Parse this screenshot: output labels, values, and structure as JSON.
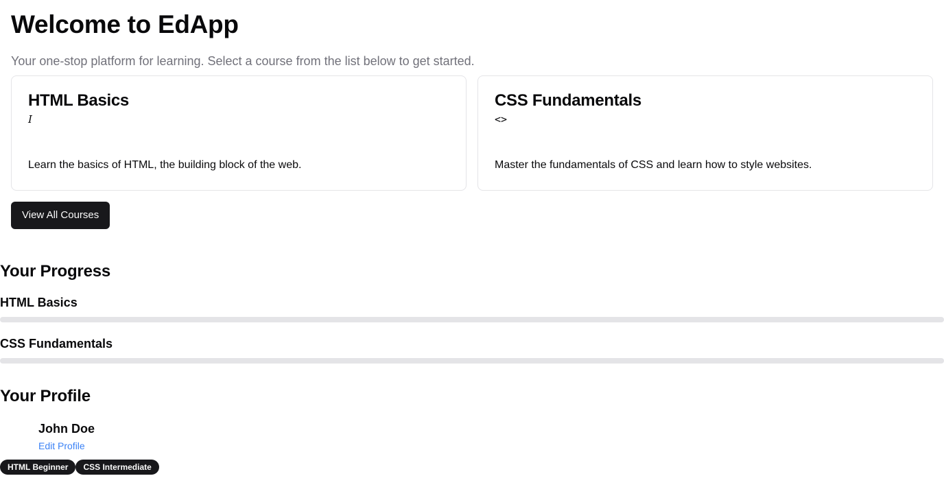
{
  "hero": {
    "title": "Welcome to EdApp",
    "subtitle": "Your one-stop platform for learning. Select a course from the list below to get started."
  },
  "courses": [
    {
      "title": "HTML Basics",
      "icon_name": "text-cursor-icon",
      "icon_glyph": "I",
      "description": "Learn the basics of HTML, the building block of the web."
    },
    {
      "title": "CSS Fundamentals",
      "icon_name": "code-icon",
      "icon_glyph": "<>",
      "description": "Master the fundamentals of CSS and learn how to style websites."
    }
  ],
  "view_all_label": "View All Courses",
  "progress": {
    "title": "Your Progress",
    "items": [
      {
        "label": "HTML Basics",
        "percent": 0
      },
      {
        "label": "CSS Fundamentals",
        "percent": 0
      }
    ]
  },
  "profile": {
    "title": "Your Profile",
    "name": "John Doe",
    "edit_label": "Edit Profile",
    "badges": [
      "HTML Beginner",
      "CSS Intermediate"
    ]
  },
  "colors": {
    "primary": "#18181b",
    "muted_text": "#71717a",
    "border": "#e4e4e7",
    "link": "#3b82f6"
  }
}
